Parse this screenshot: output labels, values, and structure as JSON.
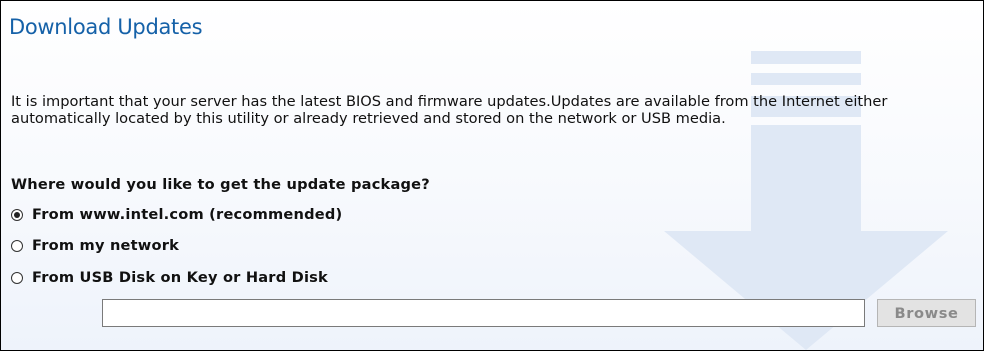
{
  "page": {
    "title": "Download Updates",
    "description": "It is important that your server has the latest BIOS and firmware updates.Updates are available from the Internet either automatically located by this utility or already retrieved and stored on the network or USB media.",
    "question": "Where would you like to get the update package?"
  },
  "options": [
    {
      "label": "From www.intel.com (recommended)",
      "selected": true
    },
    {
      "label": "From my network",
      "selected": false
    },
    {
      "label": "From USB Disk on Key or Hard Disk",
      "selected": false
    }
  ],
  "path_field": {
    "value": "",
    "placeholder": ""
  },
  "browse_button": {
    "label": "Browse",
    "enabled": false
  },
  "colors": {
    "title": "#1561a8",
    "watermark_arrow": "#dfe8f5",
    "browse_text_disabled": "#8a8a8a"
  },
  "icons": {
    "background": "download-arrow-watermark-icon"
  }
}
